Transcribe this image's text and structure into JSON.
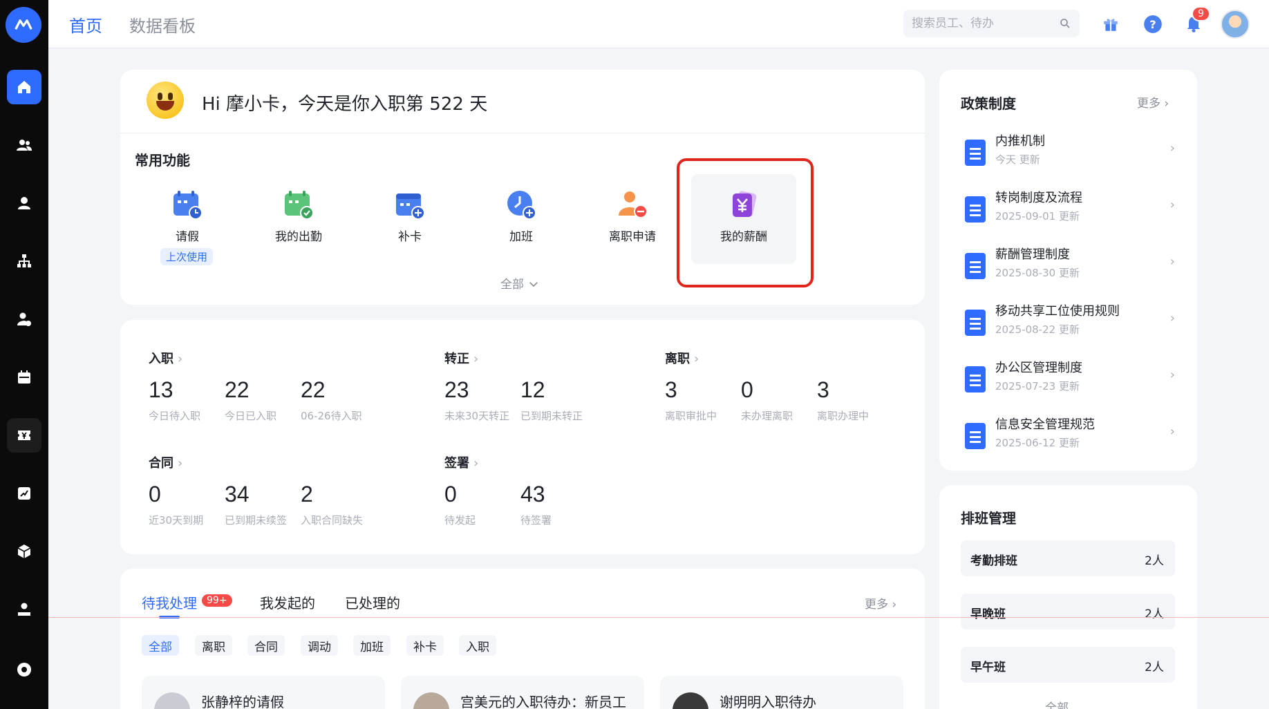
{
  "nav": {
    "tabs": [
      {
        "label": "首页",
        "active": true
      },
      {
        "label": "数据看板",
        "active": false
      }
    ]
  },
  "search": {
    "placeholder": "搜索员工、待办"
  },
  "notifications": {
    "count": "9"
  },
  "greeting": "Hi 摩小卡，今天是你入职第 522 天",
  "common": {
    "title": "常用功能",
    "items": [
      {
        "label": "请假",
        "icon": "calendar-clock-icon",
        "tag": "上次使用"
      },
      {
        "label": "我的出勤",
        "icon": "calendar-check-icon"
      },
      {
        "label": "补卡",
        "icon": "calendar-plus-icon"
      },
      {
        "label": "加班",
        "icon": "clock-plus-icon"
      },
      {
        "label": "离职申请",
        "icon": "person-minus-icon"
      },
      {
        "label": "我的薪酬",
        "icon": "yuan-card-icon",
        "selected": true
      }
    ],
    "expand_label": "全部"
  },
  "stats": {
    "onboarding": {
      "title": "入职",
      "items": [
        {
          "value": "13",
          "label": "今日待入职"
        },
        {
          "value": "22",
          "label": "今日已入职"
        },
        {
          "value": "22",
          "label": "06-26待入职"
        }
      ]
    },
    "regular": {
      "title": "转正",
      "items": [
        {
          "value": "23",
          "label": "未来30天转正"
        },
        {
          "value": "12",
          "label": "已到期未转正"
        }
      ]
    },
    "leave": {
      "title": "离职",
      "items": [
        {
          "value": "3",
          "label": "离职审批中"
        },
        {
          "value": "0",
          "label": "未办理离职"
        },
        {
          "value": "3",
          "label": "离职办理中"
        }
      ]
    },
    "contract": {
      "title": "合同",
      "items": [
        {
          "value": "0",
          "label": "近30天到期"
        },
        {
          "value": "34",
          "label": "已到期未续签"
        },
        {
          "value": "2",
          "label": "入职合同缺失"
        }
      ]
    },
    "sign": {
      "title": "签署",
      "items": [
        {
          "value": "0",
          "label": "待发起"
        },
        {
          "value": "43",
          "label": "待签署"
        }
      ]
    }
  },
  "todo": {
    "tabs": [
      "待我处理",
      "我发起的",
      "已处理的"
    ],
    "badge": "99+",
    "more": "更多",
    "chips": [
      "全部",
      "离职",
      "合同",
      "调动",
      "加班",
      "补卡",
      "入职"
    ],
    "cards": [
      {
        "title": "张静梓的请假"
      },
      {
        "title": "宫美元的入职待办：新员工"
      },
      {
        "title": "谢明明入职待办"
      }
    ]
  },
  "policy": {
    "title": "政策制度",
    "more": "更多",
    "items": [
      {
        "title": "内推机制",
        "date": "今天 更新"
      },
      {
        "title": "转岗制度及流程",
        "date": "2025-09-01 更新"
      },
      {
        "title": "薪酬管理制度",
        "date": "2025-08-30 更新"
      },
      {
        "title": "移动共享工位使用规则",
        "date": "2025-08-22 更新"
      },
      {
        "title": "办公区管理制度",
        "date": "2025-07-23 更新"
      },
      {
        "title": "信息安全管理规范",
        "date": "2025-06-12 更新"
      }
    ]
  },
  "shift": {
    "title": "排班管理",
    "items": [
      {
        "name": "考勤排班",
        "count": "2人"
      },
      {
        "name": "早晚班",
        "count": "2人"
      },
      {
        "name": "早午班",
        "count": "2人"
      }
    ],
    "all_label": "全部"
  },
  "colors": {
    "accent": "#2f6bff",
    "danger": "#f54a45",
    "highlight": "#e1251b"
  }
}
